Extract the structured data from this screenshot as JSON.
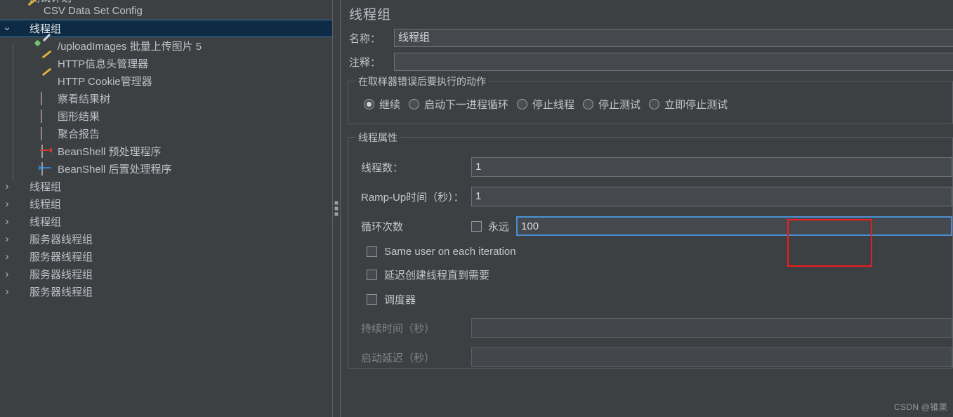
{
  "tree": {
    "items": [
      {
        "label": "测试计划",
        "icon": "test-plan-icon",
        "indent": 0,
        "twisty": "",
        "selected": false,
        "clipped": true
      },
      {
        "label": "CSV Data Set Config",
        "icon": "wrench-icon",
        "indent": 1,
        "twisty": "",
        "selected": false
      },
      {
        "label": "线程组",
        "icon": "gear-icon",
        "indent": 0,
        "twisty": "chevron-down",
        "selected": true
      },
      {
        "label": "/uploadImages 批量上传图片 5",
        "icon": "dropper-icon",
        "indent": 2,
        "twisty": "",
        "selected": false
      },
      {
        "label": "HTTP信息头管理器",
        "icon": "wrench-icon",
        "indent": 2,
        "twisty": "",
        "selected": false
      },
      {
        "label": "HTTP Cookie管理器",
        "icon": "wrench-icon",
        "indent": 2,
        "twisty": "",
        "selected": false
      },
      {
        "label": "察看结果树",
        "icon": "chart-icon",
        "indent": 2,
        "twisty": "",
        "selected": false
      },
      {
        "label": "图形结果",
        "icon": "chart-icon",
        "indent": 2,
        "twisty": "",
        "selected": false
      },
      {
        "label": "聚合报告",
        "icon": "chart-icon",
        "indent": 2,
        "twisty": "",
        "selected": false
      },
      {
        "label": "BeanShell 预处理程序",
        "icon": "doc-pre-icon",
        "indent": 2,
        "twisty": "",
        "selected": false
      },
      {
        "label": "BeanShell 后置处理程序",
        "icon": "doc-post-icon",
        "indent": 2,
        "twisty": "",
        "selected": false
      },
      {
        "label": "线程组",
        "icon": "gear-icon",
        "indent": 0,
        "twisty": "chevron-right",
        "selected": false
      },
      {
        "label": "线程组",
        "icon": "gear-icon",
        "indent": 0,
        "twisty": "chevron-right",
        "selected": false
      },
      {
        "label": "线程组",
        "icon": "gear-icon",
        "indent": 0,
        "twisty": "chevron-right",
        "selected": false
      },
      {
        "label": "服务器线程组",
        "icon": "gear-icon",
        "indent": 0,
        "twisty": "chevron-right",
        "selected": false
      },
      {
        "label": "服务器线程组",
        "icon": "gear-icon",
        "indent": 0,
        "twisty": "chevron-right",
        "selected": false
      },
      {
        "label": "服务器线程组",
        "icon": "gear-icon",
        "indent": 0,
        "twisty": "chevron-right",
        "selected": false
      },
      {
        "label": "服务器线程组",
        "icon": "gear-icon",
        "indent": 0,
        "twisty": "chevron-right",
        "selected": false
      }
    ]
  },
  "detail": {
    "title": "线程组",
    "name_label": "名称：",
    "name_value": "线程组",
    "comment_label": "注释：",
    "comment_value": "",
    "comment_placeholder": "",
    "on_error": {
      "title": "在取样器错误后要执行的动作",
      "options": [
        {
          "label": "继续",
          "selected": true
        },
        {
          "label": "启动下一进程循环",
          "selected": false
        },
        {
          "label": "停止线程",
          "selected": false
        },
        {
          "label": "停止测试",
          "selected": false
        },
        {
          "label": "立即停止测试",
          "selected": false
        }
      ]
    },
    "thread_props": {
      "title": "线程属性",
      "num_threads_label": "线程数：",
      "num_threads_value": "1",
      "ramp_up_label": "Ramp-Up时间（秒）：",
      "ramp_up_value": "1",
      "loop_count_label": "循环次数",
      "forever_label": "永远",
      "forever_checked": false,
      "loop_count_value": "100",
      "same_user_label": "Same user on each iteration",
      "same_user_checked": false,
      "delay_create_label": "延迟创建线程直到需要",
      "delay_create_checked": false,
      "scheduler_label": "调度器",
      "scheduler_checked": false,
      "duration_label": "持续时间（秒）",
      "duration_value": "",
      "startup_delay_label": "启动延迟（秒）",
      "startup_delay_value": ""
    }
  },
  "annotation": {
    "color": "#ee1c1c"
  },
  "watermark": {
    "text": "CSDN @锥栗"
  },
  "colors": {
    "background": "#3c4043",
    "selection": "#0d2b44",
    "selection_border": "#3e6fa8",
    "focus_border": "#4a8fd4",
    "text": "#c3c7cb"
  }
}
